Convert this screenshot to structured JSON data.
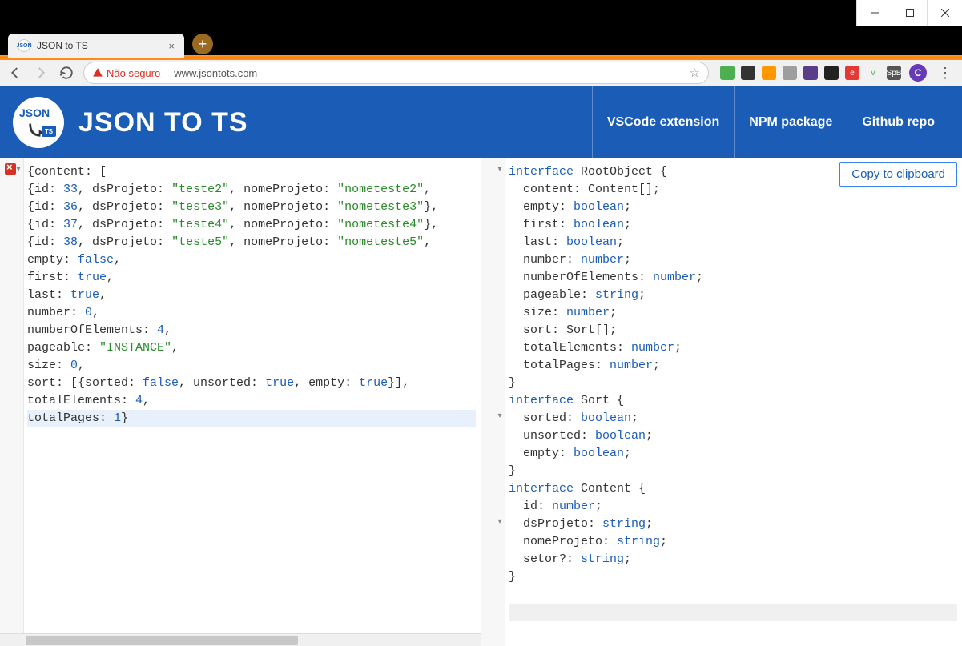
{
  "window": {
    "tab_title": "JSON to TS",
    "tab_favicon_text": "JSON",
    "minimize": "—",
    "maximize": "▢",
    "close": "✕",
    "new_tab": "+"
  },
  "address": {
    "not_secure_label": "Não seguro",
    "url": "www.jsontots.com",
    "avatar_letter": "C"
  },
  "header": {
    "title": "JSON TO TS",
    "links": [
      "VSCode extension",
      "NPM package",
      "Github repo"
    ]
  },
  "copy_button": "Copy to clipboard",
  "json_input": {
    "lines": [
      [
        {
          "t": "{"
        },
        {
          "t": "content: ["
        }
      ],
      [
        {
          "t": "{id: "
        },
        {
          "t": "33",
          "c": "tok-num"
        },
        {
          "t": ", dsProjeto: "
        },
        {
          "t": "\"teste2\"",
          "c": "tok-str"
        },
        {
          "t": ", nomeProjeto: "
        },
        {
          "t": "\"nometeste2\"",
          "c": "tok-str"
        },
        {
          "t": ","
        }
      ],
      [
        {
          "t": "{id: "
        },
        {
          "t": "36",
          "c": "tok-num"
        },
        {
          "t": ", dsProjeto: "
        },
        {
          "t": "\"teste3\"",
          "c": "tok-str"
        },
        {
          "t": ", nomeProjeto: "
        },
        {
          "t": "\"nometeste3\"",
          "c": "tok-str"
        },
        {
          "t": "},"
        }
      ],
      [
        {
          "t": "{id: "
        },
        {
          "t": "37",
          "c": "tok-num"
        },
        {
          "t": ", dsProjeto: "
        },
        {
          "t": "\"teste4\"",
          "c": "tok-str"
        },
        {
          "t": ", nomeProjeto: "
        },
        {
          "t": "\"nometeste4\"",
          "c": "tok-str"
        },
        {
          "t": "},"
        }
      ],
      [
        {
          "t": "{id: "
        },
        {
          "t": "38",
          "c": "tok-num"
        },
        {
          "t": ", dsProjeto: "
        },
        {
          "t": "\"teste5\"",
          "c": "tok-str"
        },
        {
          "t": ", nomeProjeto: "
        },
        {
          "t": "\"nometeste5\"",
          "c": "tok-str"
        },
        {
          "t": ","
        }
      ],
      [
        {
          "t": "empty: "
        },
        {
          "t": "false",
          "c": "tok-bool"
        },
        {
          "t": ","
        }
      ],
      [
        {
          "t": "first: "
        },
        {
          "t": "true",
          "c": "tok-bool"
        },
        {
          "t": ","
        }
      ],
      [
        {
          "t": "last: "
        },
        {
          "t": "true",
          "c": "tok-bool"
        },
        {
          "t": ","
        }
      ],
      [
        {
          "t": "number: "
        },
        {
          "t": "0",
          "c": "tok-num"
        },
        {
          "t": ","
        }
      ],
      [
        {
          "t": "numberOfElements: "
        },
        {
          "t": "4",
          "c": "tok-num"
        },
        {
          "t": ","
        }
      ],
      [
        {
          "t": "pageable: "
        },
        {
          "t": "\"INSTANCE\"",
          "c": "tok-str"
        },
        {
          "t": ","
        }
      ],
      [
        {
          "t": "size: "
        },
        {
          "t": "0",
          "c": "tok-num"
        },
        {
          "t": ","
        }
      ],
      [
        {
          "t": "sort: [{sorted: "
        },
        {
          "t": "false",
          "c": "tok-bool"
        },
        {
          "t": ", unsorted: "
        },
        {
          "t": "true",
          "c": "tok-bool"
        },
        {
          "t": ", empty: "
        },
        {
          "t": "true",
          "c": "tok-bool"
        },
        {
          "t": "}],"
        }
      ],
      [
        {
          "t": "totalElements: "
        },
        {
          "t": "4",
          "c": "tok-num"
        },
        {
          "t": ","
        }
      ],
      [
        {
          "t": "totalPages: "
        },
        {
          "t": "1",
          "c": "tok-num"
        },
        {
          "t": "}"
        }
      ]
    ],
    "highlight_line": 14
  },
  "ts_output": {
    "lines": [
      [
        {
          "t": "interface ",
          "c": "tok-kw"
        },
        {
          "t": "RootObject {"
        }
      ],
      [
        {
          "t": "  content: Content[];"
        }
      ],
      [
        {
          "t": "  empty: "
        },
        {
          "t": "boolean",
          "c": "tok-kw"
        },
        {
          "t": ";"
        }
      ],
      [
        {
          "t": "  first: "
        },
        {
          "t": "boolean",
          "c": "tok-kw"
        },
        {
          "t": ";"
        }
      ],
      [
        {
          "t": "  last: "
        },
        {
          "t": "boolean",
          "c": "tok-kw"
        },
        {
          "t": ";"
        }
      ],
      [
        {
          "t": "  number: "
        },
        {
          "t": "number",
          "c": "tok-kw"
        },
        {
          "t": ";"
        }
      ],
      [
        {
          "t": "  numberOfElements: "
        },
        {
          "t": "number",
          "c": "tok-kw"
        },
        {
          "t": ";"
        }
      ],
      [
        {
          "t": "  pageable: "
        },
        {
          "t": "string",
          "c": "tok-kw"
        },
        {
          "t": ";"
        }
      ],
      [
        {
          "t": "  size: "
        },
        {
          "t": "number",
          "c": "tok-kw"
        },
        {
          "t": ";"
        }
      ],
      [
        {
          "t": "  sort: Sort[];"
        }
      ],
      [
        {
          "t": "  totalElements: "
        },
        {
          "t": "number",
          "c": "tok-kw"
        },
        {
          "t": ";"
        }
      ],
      [
        {
          "t": "  totalPages: "
        },
        {
          "t": "number",
          "c": "tok-kw"
        },
        {
          "t": ";"
        }
      ],
      [
        {
          "t": "}"
        }
      ],
      [
        {
          "t": ""
        }
      ],
      [
        {
          "t": "interface ",
          "c": "tok-kw"
        },
        {
          "t": "Sort {"
        }
      ],
      [
        {
          "t": "  sorted: "
        },
        {
          "t": "boolean",
          "c": "tok-kw"
        },
        {
          "t": ";"
        }
      ],
      [
        {
          "t": "  unsorted: "
        },
        {
          "t": "boolean",
          "c": "tok-kw"
        },
        {
          "t": ";"
        }
      ],
      [
        {
          "t": "  empty: "
        },
        {
          "t": "boolean",
          "c": "tok-kw"
        },
        {
          "t": ";"
        }
      ],
      [
        {
          "t": "}"
        }
      ],
      [
        {
          "t": ""
        }
      ],
      [
        {
          "t": "interface ",
          "c": "tok-kw"
        },
        {
          "t": "Content {"
        }
      ],
      [
        {
          "t": "  id: "
        },
        {
          "t": "number",
          "c": "tok-kw"
        },
        {
          "t": ";"
        }
      ],
      [
        {
          "t": "  dsProjeto: "
        },
        {
          "t": "string",
          "c": "tok-kw"
        },
        {
          "t": ";"
        }
      ],
      [
        {
          "t": "  nomeProjeto: "
        },
        {
          "t": "string",
          "c": "tok-kw"
        },
        {
          "t": ";"
        }
      ],
      [
        {
          "t": "  setor?: "
        },
        {
          "t": "string",
          "c": "tok-kw"
        },
        {
          "t": ";"
        }
      ],
      [
        {
          "t": "}"
        }
      ]
    ],
    "folds": [
      0,
      14,
      20
    ],
    "highlight_line": 25
  },
  "extensions": [
    {
      "name": "green-dot",
      "bg": "#4caf50"
    },
    {
      "name": "terminal",
      "bg": "#333"
    },
    {
      "name": "orange-diamond",
      "bg": "#ff9800"
    },
    {
      "name": "cube",
      "bg": "#9e9e9e"
    },
    {
      "name": "redux",
      "bg": "#593d88"
    },
    {
      "name": "react",
      "bg": "#222"
    },
    {
      "name": "e-red",
      "bg": "#e53935",
      "txt": "e"
    },
    {
      "name": "vue",
      "bg": "transparent",
      "txt": "V",
      "col": "#4caf50"
    },
    {
      "name": "spb",
      "bg": "#555",
      "txt": "SpB"
    }
  ]
}
